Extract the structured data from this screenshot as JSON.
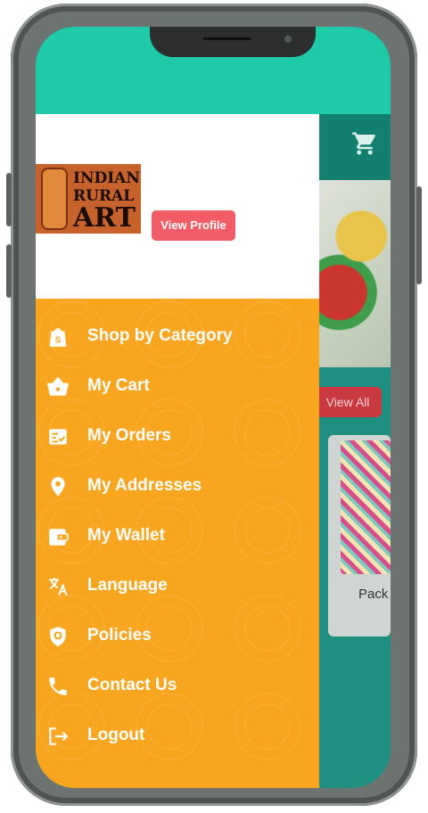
{
  "app": {
    "view_all": "View All",
    "product_name": "Pack"
  },
  "header": {
    "logo_lines": [
      "INDIAN",
      "RURAL",
      "ART"
    ],
    "view_profile": "View Profile"
  },
  "menu": [
    {
      "label": "Shop by Category",
      "icon": "shopping-bag-icon"
    },
    {
      "label": "My Cart",
      "icon": "basket-icon"
    },
    {
      "label": "My Orders",
      "icon": "orders-icon"
    },
    {
      "label": "My Addresses",
      "icon": "location-pin-icon"
    },
    {
      "label": "My Wallet",
      "icon": "wallet-icon"
    },
    {
      "label": "Language",
      "icon": "translate-icon"
    },
    {
      "label": "Policies",
      "icon": "shield-icon"
    },
    {
      "label": "Contact Us",
      "icon": "phone-icon"
    },
    {
      "label": "Logout",
      "icon": "logout-icon"
    }
  ],
  "colors": {
    "teal": "#1fcaa8",
    "drawer_orange": "#f8a61f",
    "profile_button": "#f25c66"
  }
}
